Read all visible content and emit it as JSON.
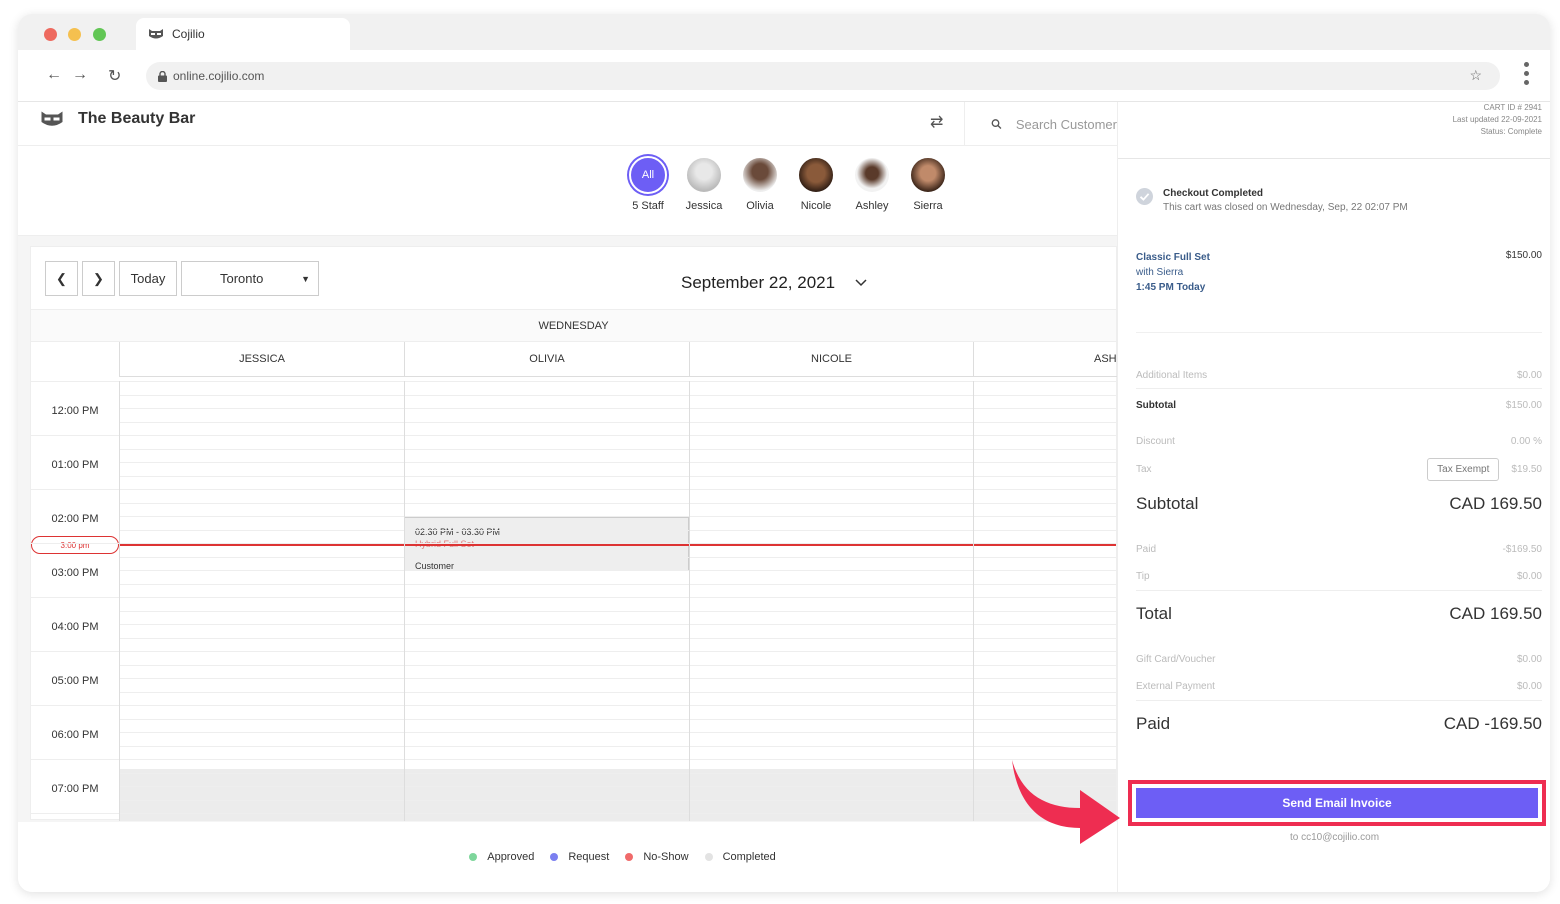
{
  "browser": {
    "tab_title": "Cojilio",
    "url": "online.cojilio.com"
  },
  "app": {
    "business_name": "The Beauty Bar",
    "search_placeholder": "Search Customer"
  },
  "staff": [
    {
      "name": "5 Staff",
      "avatar_text": "All"
    },
    {
      "name": "Jessica"
    },
    {
      "name": "Olivia"
    },
    {
      "name": "Nicole"
    },
    {
      "name": "Ashley"
    },
    {
      "name": "Sierra"
    }
  ],
  "calendar": {
    "today_label": "Today",
    "location": "Toronto",
    "date_title": "September 22, 2021",
    "weekday": "WEDNESDAY",
    "columns": [
      "JESSICA",
      "OLIVIA",
      "NICOLE",
      "ASHLEY"
    ],
    "times": [
      "12:00 PM",
      "01:00 PM",
      "02:00 PM",
      "03:00 PM",
      "04:00 PM",
      "05:00 PM",
      "06:00 PM",
      "07:00 PM"
    ],
    "now_label": "3:00 pm",
    "appointment": {
      "time": "02:30 PM - 03:30 PM",
      "service": "Hybrid Full Set",
      "customer": "Customer"
    }
  },
  "legend": [
    {
      "label": "Approved",
      "color": "#7ed69b"
    },
    {
      "label": "Request",
      "color": "#7b7ff0"
    },
    {
      "label": "No-Show",
      "color": "#f06a6a"
    },
    {
      "label": "Completed",
      "color": "#e3e3e3"
    }
  ],
  "cart": {
    "cart_id": "CART ID # 2941",
    "last_updated": "Last updated 22-09-2021",
    "status": "Status: Complete",
    "checkout_title": "Checkout Completed",
    "checkout_desc": "This cart was closed on Wednesday, Sep, 22 02:07 PM",
    "item_name": "Classic Full Set",
    "item_staff": "with Sierra",
    "item_time": "1:45 PM Today",
    "item_price": "$150.00",
    "additional_items_label": "Additional Items",
    "additional_items_value": "$0.00",
    "subtotal_label": "Subtotal",
    "subtotal_value": "$150.00",
    "discount_label": "Discount",
    "discount_value": "0.00 %",
    "tax_label": "Tax",
    "tax_exempt_label": "Tax Exempt",
    "tax_value": "$19.50",
    "grand_subtotal_label": "Subtotal",
    "grand_subtotal_value": "CAD 169.50",
    "paid_label": "Paid",
    "paid_value": "-$169.50",
    "tip_label": "Tip",
    "tip_value": "$0.00",
    "total_label": "Total",
    "total_value": "CAD 169.50",
    "gift_label": "Gift Card/Voucher",
    "gift_value": "$0.00",
    "external_label": "External Payment",
    "external_value": "$0.00",
    "paid_total_label": "Paid",
    "paid_total_value": "CAD -169.50",
    "send_button": "Send Email Invoice",
    "send_to": "to cc10@cojilio.com"
  },
  "colors": {
    "accent": "#6d5ef5",
    "highlight": "#ee2d51",
    "now_line": "#dd3333"
  }
}
